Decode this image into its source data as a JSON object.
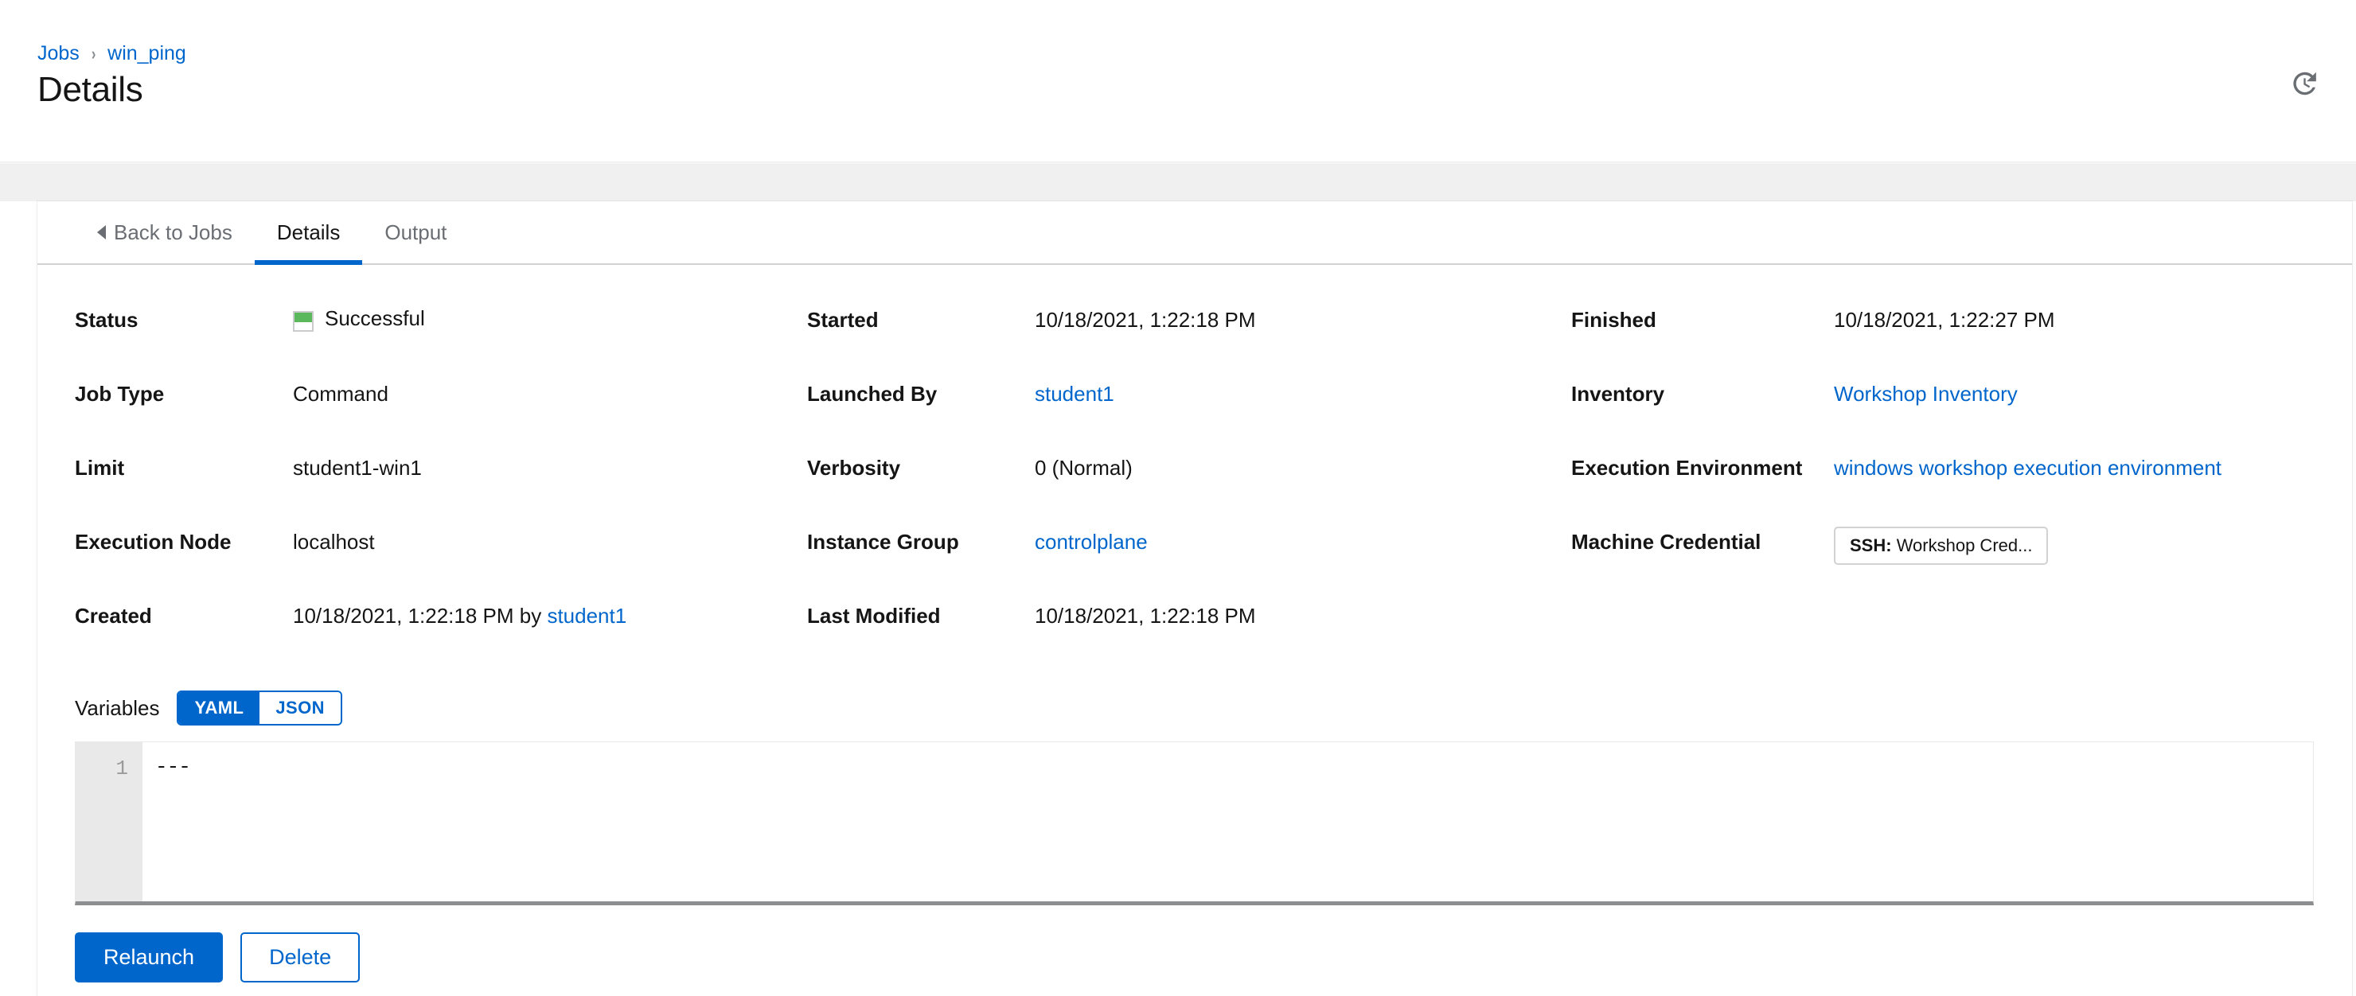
{
  "header": {
    "breadcrumb": [
      {
        "label": "Jobs",
        "name": "breadcrumb-jobs"
      },
      {
        "label": "win_ping",
        "name": "breadcrumb-win-ping"
      }
    ],
    "separator": "›",
    "title": "Details",
    "history_icon": "history-icon"
  },
  "tabs": [
    {
      "label": "Back to Jobs",
      "active": false
    },
    {
      "label": "Details",
      "active": true
    },
    {
      "label": "Output",
      "active": false
    }
  ],
  "details": {
    "column1": [
      {
        "label": "Status",
        "value": "Successful",
        "type": "status",
        "status_color": "#5cb85c"
      },
      {
        "label": "Job Type",
        "value": "Command",
        "type": "text"
      },
      {
        "label": "Limit",
        "value": "student1-win1",
        "type": "text"
      },
      {
        "label": "Execution Node",
        "value": "localhost",
        "type": "text"
      }
    ],
    "column2": [
      {
        "label": "Started",
        "value": "10/18/2021, 1:22:18 PM",
        "type": "text"
      },
      {
        "label": "Launched By",
        "value": "student1",
        "type": "link"
      },
      {
        "label": "Verbosity",
        "value": "0 (Normal)",
        "type": "text"
      },
      {
        "label": "Instance Group",
        "value": "controlplane",
        "type": "link"
      }
    ],
    "column3": [
      {
        "label": "Finished",
        "value": "10/18/2021, 1:22:27 PM",
        "type": "text"
      },
      {
        "label": "Inventory",
        "value": "Workshop Inventory",
        "type": "link"
      },
      {
        "label": "Execution Environment",
        "value": "windows workshop execution environment",
        "type": "link"
      },
      {
        "label": "Machine Credential",
        "value": "Workshop Cred...",
        "value_prefix": "SSH:",
        "type": "chip"
      }
    ],
    "created": {
      "label": "Created",
      "value_prefix": "10/18/2021, 1:22:18 PM by ",
      "value_link": "student1"
    },
    "last_modified": {
      "label": "Last Modified",
      "value": "10/18/2021, 1:22:18 PM"
    }
  },
  "variables": {
    "label": "Variables",
    "format_yaml": "YAML",
    "format_json": "JSON",
    "active_format": "YAML",
    "line_number": "1",
    "content": "---"
  },
  "actions": {
    "relaunch_label": "Relaunch",
    "delete_label": "Delete"
  },
  "colors": {
    "accent": "#0066cc",
    "success": "#5cb85c",
    "text": "#151515",
    "muted": "#6a6e73",
    "band": "#f0f0f0"
  }
}
